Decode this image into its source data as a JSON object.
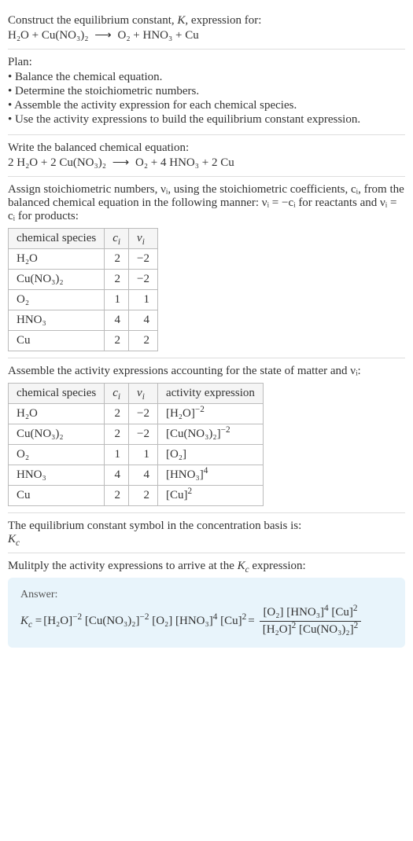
{
  "header": {
    "line1": "Construct the equilibrium constant, K, expression for:",
    "equation_lhs": "H₂O + Cu(NO₃)₂",
    "arrow": "⟶",
    "equation_rhs": "O₂ + HNO₃ + Cu"
  },
  "plan": {
    "title": "Plan:",
    "items": [
      "• Balance the chemical equation.",
      "• Determine the stoichiometric numbers.",
      "• Assemble the activity expression for each chemical species.",
      "• Use the activity expressions to build the equilibrium constant expression."
    ]
  },
  "balanced": {
    "title": "Write the balanced chemical equation:",
    "equation_lhs": "2 H₂O + 2 Cu(NO₃)₂",
    "arrow": "⟶",
    "equation_rhs": "O₂ + 4 HNO₃ + 2 Cu"
  },
  "stoich": {
    "intro": "Assign stoichiometric numbers, νᵢ, using the stoichiometric coefficients, cᵢ, from the balanced chemical equation in the following manner: νᵢ = −cᵢ for reactants and νᵢ = cᵢ for products:",
    "headers": {
      "h1": "chemical species",
      "h2": "cᵢ",
      "h3": "νᵢ"
    },
    "rows": [
      {
        "species": "H₂O",
        "c": "2",
        "v": "−2"
      },
      {
        "species": "Cu(NO₃)₂",
        "c": "2",
        "v": "−2"
      },
      {
        "species": "O₂",
        "c": "1",
        "v": "1"
      },
      {
        "species": "HNO₃",
        "c": "4",
        "v": "4"
      },
      {
        "species": "Cu",
        "c": "2",
        "v": "2"
      }
    ]
  },
  "activity": {
    "intro": "Assemble the activity expressions accounting for the state of matter and νᵢ:",
    "headers": {
      "h1": "chemical species",
      "h2": "cᵢ",
      "h3": "νᵢ",
      "h4": "activity expression"
    },
    "rows": [
      {
        "species": "H₂O",
        "c": "2",
        "v": "−2",
        "act_base": "[H₂O]",
        "act_exp": "−2"
      },
      {
        "species": "Cu(NO₃)₂",
        "c": "2",
        "v": "−2",
        "act_base": "[Cu(NO₃)₂]",
        "act_exp": "−2"
      },
      {
        "species": "O₂",
        "c": "1",
        "v": "1",
        "act_base": "[O₂]",
        "act_exp": ""
      },
      {
        "species": "HNO₃",
        "c": "4",
        "v": "4",
        "act_base": "[HNO₃]",
        "act_exp": "4"
      },
      {
        "species": "Cu",
        "c": "2",
        "v": "2",
        "act_base": "[Cu]",
        "act_exp": "2"
      }
    ]
  },
  "symbol": {
    "line1": "The equilibrium constant symbol in the concentration basis is:",
    "line2": "K꜀"
  },
  "final": {
    "intro": "Mulitply the activity expressions to arrive at the K꜀ expression:",
    "answer_label": "Answer:",
    "kc": "K꜀ = ",
    "flat": {
      "t1": "[H₂O]",
      "e1": "−2",
      "t2": " [Cu(NO₃)₂]",
      "e2": "−2",
      "t3": " [O₂] [HNO₃]",
      "e3": "4",
      "t4": " [Cu]",
      "e4": "2"
    },
    "eq": " = ",
    "frac": {
      "num": {
        "t1": "[O₂] [HNO₃]",
        "e1": "4",
        "t2": " [Cu]",
        "e2": "2"
      },
      "den": {
        "t1": "[H₂O]",
        "e1": "2",
        "t2": " [Cu(NO₃)₂]",
        "e2": "2"
      }
    }
  }
}
